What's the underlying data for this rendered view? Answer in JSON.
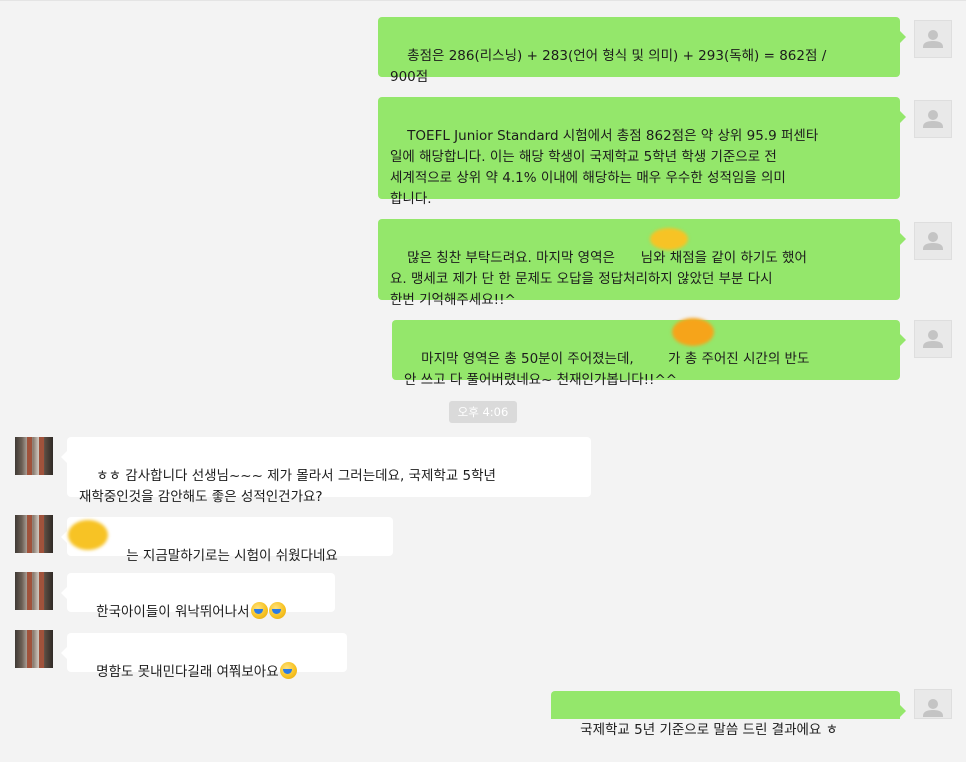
{
  "conversation": {
    "messages": [
      {
        "id": "m1",
        "sender": "me",
        "text": "총점은 286(리스닝) + 283(언어 형식 및 의미) + 293(독해) = 862점 /\n900점"
      },
      {
        "id": "m2",
        "sender": "me",
        "text": "TOEFL Junior Standard 시험에서 총점 862점은 약 상위 95.9 퍼센타\n일에 해당합니다. 이는 해당 학생이 국제학교 5학년 학생 기준으로 전\n세계적으로 상위 약 4.1% 이내에 해당하는 매우 우수한 성적임을 의미\n합니다."
      },
      {
        "id": "m3",
        "sender": "me",
        "text": "많은 칭찬 부탁드려요. 마지막 영역은      님와 채점을 같이 하기도 했어\n요. 맹세코 제가 단 한 문제도 오답을 정답처리하지 않았던 부분 다시\n한번 기억해주세요!!^"
      },
      {
        "id": "m4",
        "sender": "me",
        "text": "마지막 영역은 총 50분이 주어졌는데,        가 총 주어진 시간의 반도\n안 쓰고 다 풀어버렸네요~ 천재인가봅니다!!^^"
      },
      {
        "id": "m5",
        "sender": "other",
        "text": "ㅎㅎ 감사합니다 선생님~~~ 제가 몰라서 그러는데요, 국제학교 5학년\n재학중인것을 감안해도 좋은 성적인건가요?"
      },
      {
        "id": "m6",
        "sender": "other",
        "text": "       는 지금말하기로는 시험이 쉬웠다네요"
      },
      {
        "id": "m7",
        "sender": "other",
        "text": "한국아이들이 워낙뛰어나서"
      },
      {
        "id": "m8",
        "sender": "other",
        "text": "명함도 못내민다길래 여쭤보아요"
      },
      {
        "id": "m9",
        "sender": "me",
        "text": "국제학교 5년 기준으로 말씀 드린 결과에요 ㅎ"
      }
    ],
    "time_divider": "오후 4:06"
  },
  "emoji": {
    "m7": [
      "sweat-smile-icon",
      "sweat-smile-icon"
    ],
    "m8": [
      "sweat-smile-icon"
    ]
  },
  "colors": {
    "background": "#f3f3f3",
    "sent_bubble": "#94e76b",
    "received_bubble": "#ffffff",
    "time_divider": "#dadada",
    "redaction": "#f7c325"
  }
}
